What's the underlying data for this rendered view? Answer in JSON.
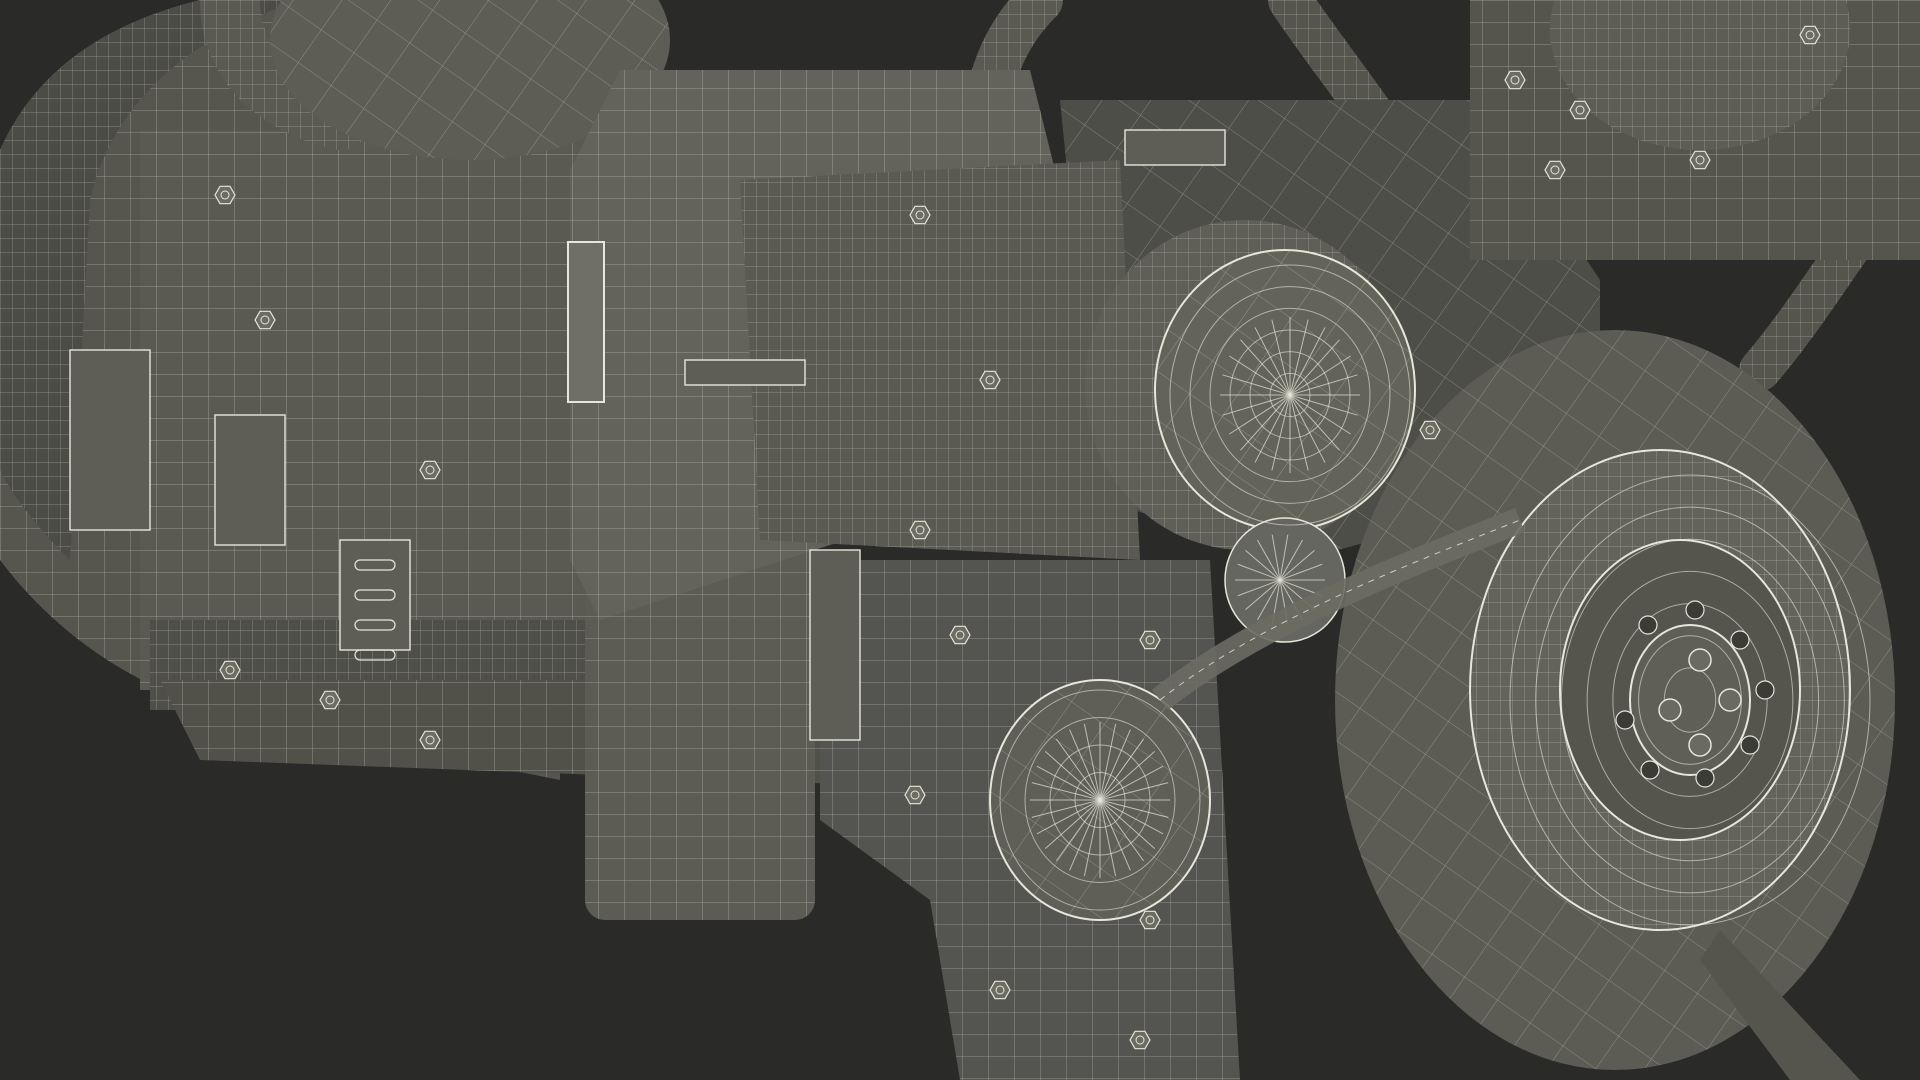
{
  "scene": {
    "subject": "engine-wireframe-render",
    "colors": {
      "background": "#2a2a28",
      "surface_dark": "#4a4a44",
      "surface_mid": "#5b5b54",
      "surface_light": "#6a6a62",
      "wire": "#e6e6da",
      "wire_dim": "#c9c9bc"
    }
  }
}
